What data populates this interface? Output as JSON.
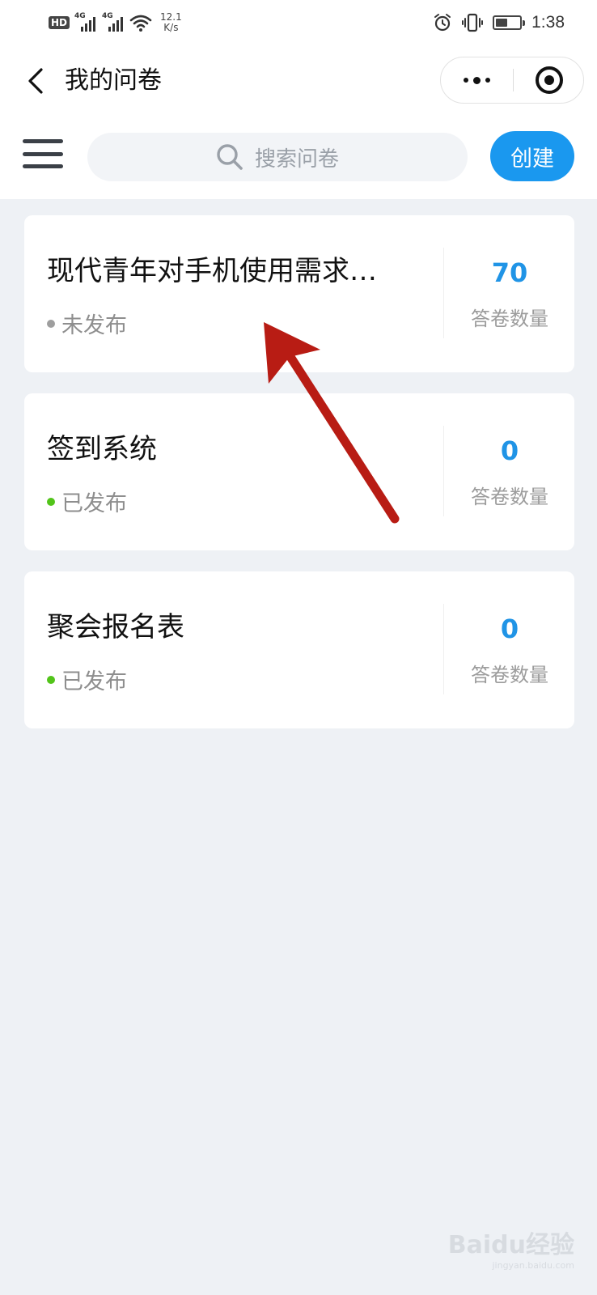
{
  "status_bar": {
    "hd_label": "HD",
    "network_1": "4G",
    "network_2": "4G",
    "speed_value": "12.1",
    "speed_unit": "K/s",
    "time": "1:38"
  },
  "nav": {
    "title": "我的问卷"
  },
  "toolbar": {
    "search_placeholder": "搜索问卷",
    "create_label": "创建"
  },
  "surveys": [
    {
      "title": "现代青年对手机使用需求…",
      "status": "未发布",
      "status_color": "#9e9e9e",
      "count": "70",
      "count_label": "答卷数量"
    },
    {
      "title": "签到系统",
      "status": "已发布",
      "status_color": "#52c41a",
      "count": "0",
      "count_label": "答卷数量"
    },
    {
      "title": "聚会报名表",
      "status": "已发布",
      "status_color": "#52c41a",
      "count": "0",
      "count_label": "答卷数量"
    }
  ],
  "colors": {
    "accent": "#1a98ef",
    "count_blue": "#2094e6",
    "page_bg": "#eef1f5",
    "arrow_red": "#b81c14"
  },
  "watermark": {
    "brand": "Baidu经验",
    "url": "jingyan.baidu.com"
  }
}
